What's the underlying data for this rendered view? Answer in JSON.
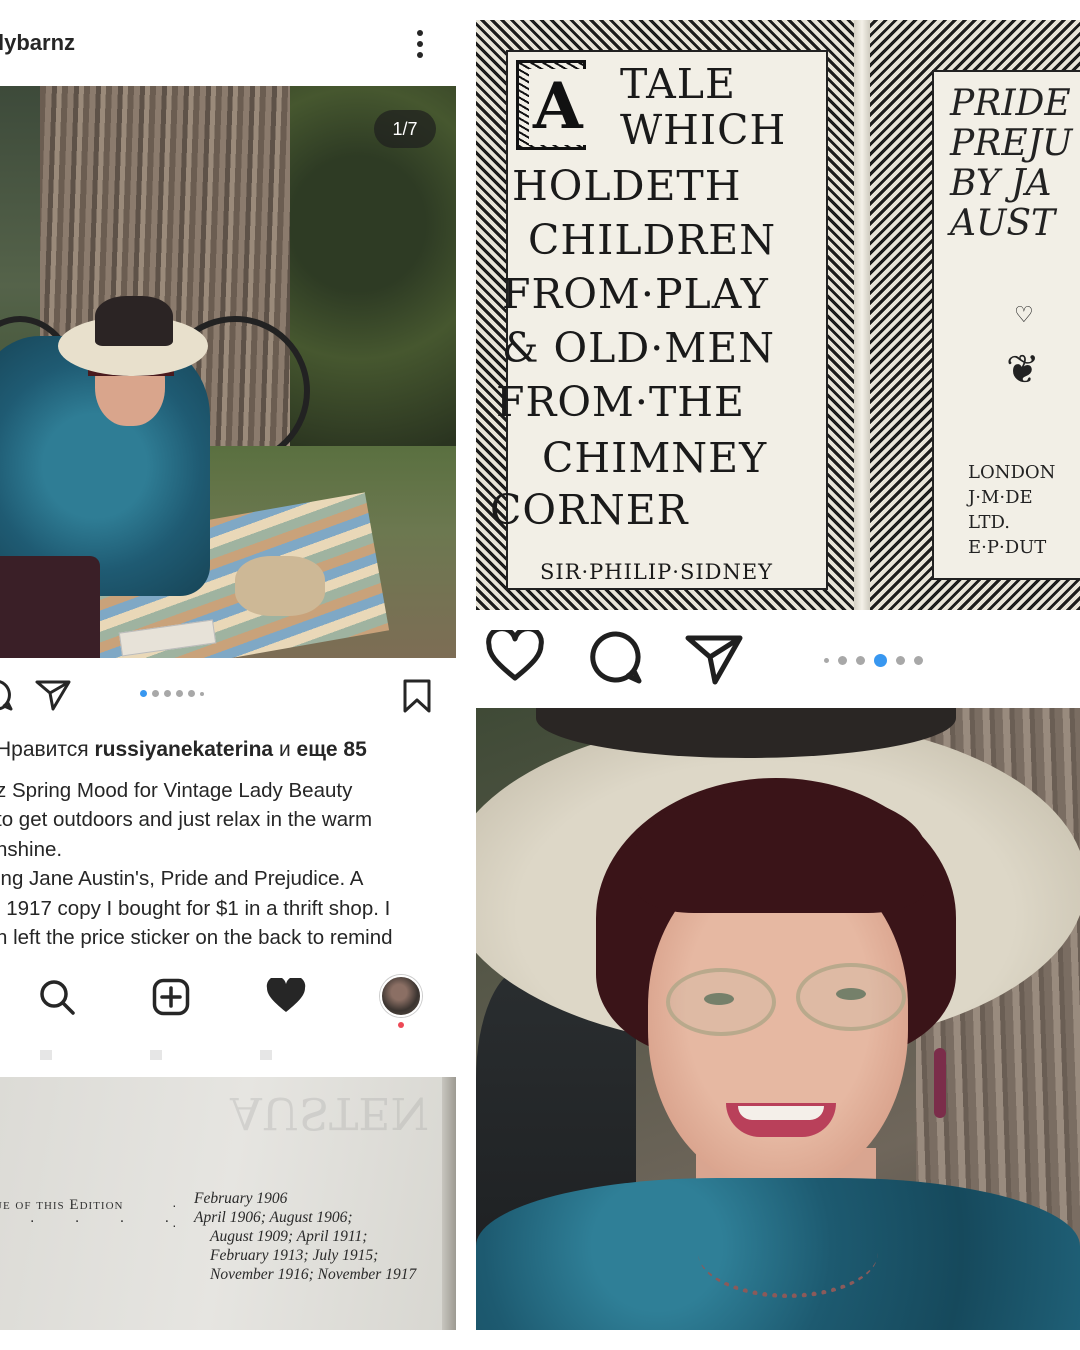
{
  "instagram": {
    "username": "lybarnz",
    "counter": "1/7",
    "likes": {
      "prefix": "Нравится ",
      "user": "russiyanekaterina",
      "middle": " и ",
      "suffix": "еще 85"
    },
    "caption_lines": [
      "z Spring Mood for Vintage Lady Beauty",
      " to get outdoors and just relax in the warm",
      "nshine.",
      "ing Jane Austin's, Pride and Prejudice. A",
      "l 1917 copy I bought for $1 in a thrift shop. I",
      "n left the price sticker on the back to remind"
    ],
    "icons": [
      "comment-icon",
      "share-icon",
      "bookmark-icon",
      "search-icon",
      "add-post-icon",
      "heart-icon",
      "profile-avatar"
    ]
  },
  "edition_page": {
    "ghost_title": "AUSTEN",
    "label": "ue of this Edition",
    "dates": [
      "February 1906",
      "April 1906; August 1906;",
      "August 1909; April 1911;",
      "February 1913; July 1915;",
      "November 1916; November 1917"
    ]
  },
  "book": {
    "drop_cap": "A",
    "title_lines": [
      "TALE",
      "WHICH",
      "HOLDETH",
      "CHILDREN",
      "FROM·PLAY",
      "& OLD·MEN",
      "FROM·THE",
      "CHIMNEY",
      "CORNER"
    ],
    "author": "SIR·PHILIP·SIDNEY",
    "right_title_lines": [
      "PRIDE",
      "PREJU",
      "BY JA",
      "AUST"
    ],
    "publisher_lines": [
      "LONDON",
      "J·M·DE",
      "LTD.",
      "E·P·DUT"
    ]
  },
  "colors": {
    "accent": "#3897f0",
    "text": "#262626",
    "notification": "#ed4956"
  }
}
